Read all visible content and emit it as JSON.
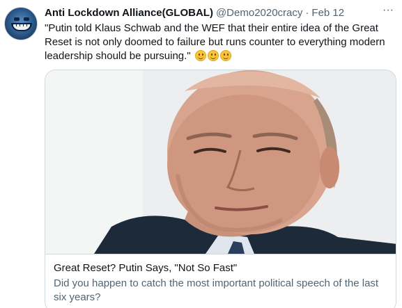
{
  "tweet": {
    "author_name": "Anti Lockdown Alliance(GLOBAL)",
    "author_handle": "@Demo2020cracy",
    "separator": "·",
    "date": "Feb 12",
    "more_label": "···",
    "text_lines": [
      "\"Putin told Klaus Schwab and the WEF that their entire idea of the Great",
      "Reset is not only doomed to failure but runs counter to everything modern",
      "leadership should be pursuing.\""
    ],
    "emoji_count": 3,
    "emoji_name": "slightly-smiling-face"
  },
  "card": {
    "title": "Great Reset? Putin Says, \"Not So Fast\"",
    "description": "Did you happen to catch the most important political speech of the last six years?"
  },
  "colors": {
    "text_primary": "#0f1419",
    "text_secondary": "#536471",
    "border": "#cfd9de"
  }
}
